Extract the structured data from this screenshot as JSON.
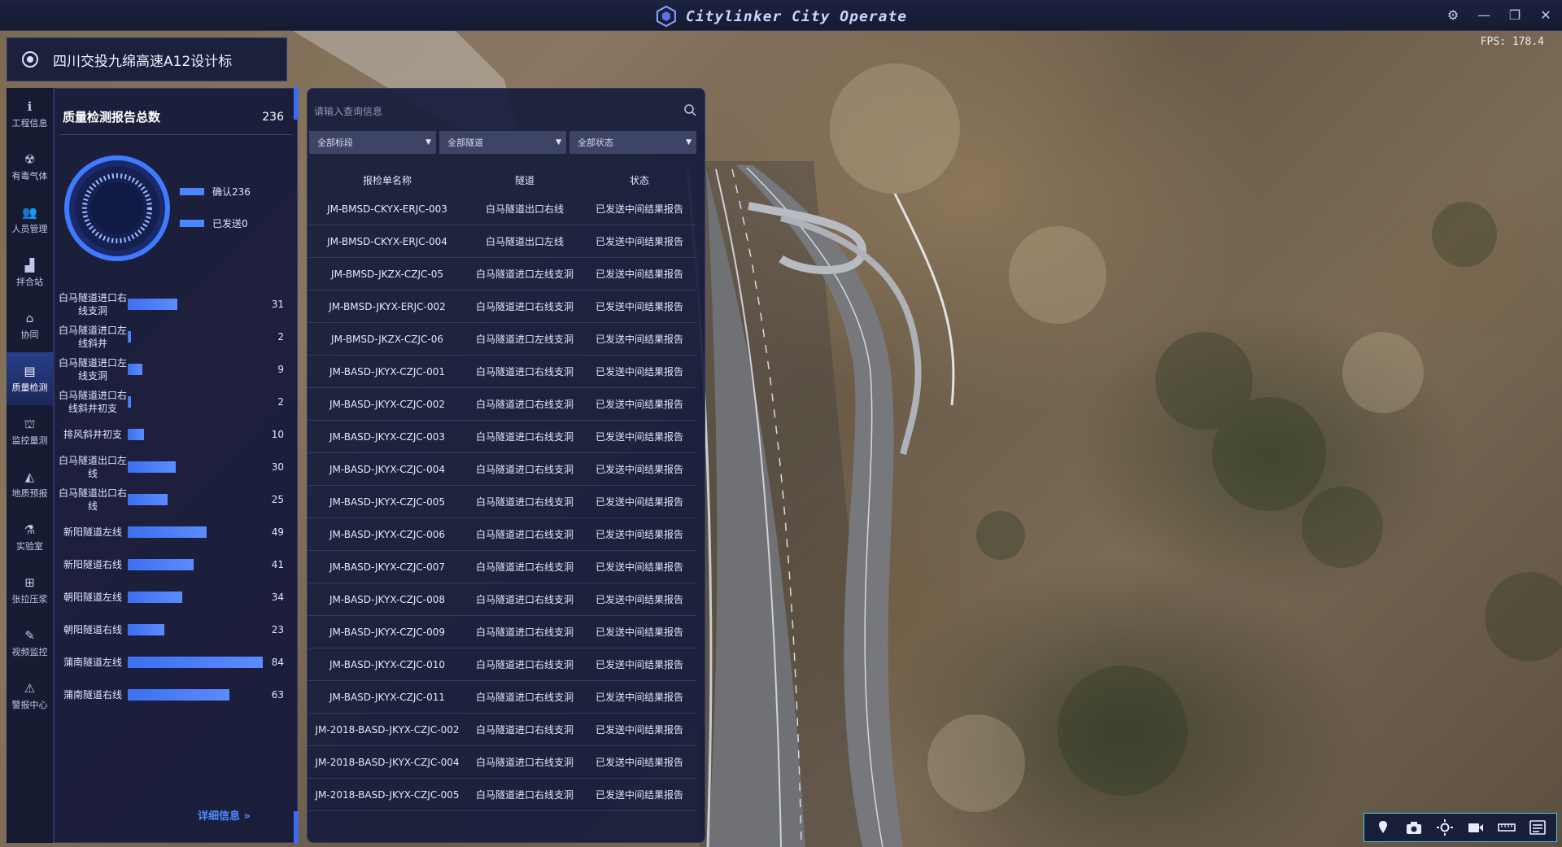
{
  "app": {
    "brand": "Citylinker City Operate",
    "fps": "FPS: 178.4"
  },
  "window_controls": [
    "settings-icon",
    "minimize-icon",
    "restore-icon",
    "close-icon"
  ],
  "project": {
    "title": "四川交投九绵高速A12设计标"
  },
  "nav": {
    "items": [
      {
        "label": "工程信息",
        "icon": "info-icon"
      },
      {
        "label": "有毒气体",
        "icon": "gas-icon"
      },
      {
        "label": "人员管理",
        "icon": "people-icon"
      },
      {
        "label": "拌合站",
        "icon": "plant-icon"
      },
      {
        "label": "协同",
        "icon": "cooperate-icon"
      },
      {
        "label": "质量检测",
        "icon": "quality-icon",
        "active": true
      },
      {
        "label": "监控量测",
        "icon": "monitor-icon"
      },
      {
        "label": "地质预报",
        "icon": "geology-icon"
      },
      {
        "label": "实验室",
        "icon": "lab-icon"
      },
      {
        "label": "张拉压浆",
        "icon": "tension-icon"
      },
      {
        "label": "视频监控",
        "icon": "video-icon"
      },
      {
        "label": "警报中心",
        "icon": "alarm-icon"
      }
    ]
  },
  "stats": {
    "title": "质量检测报告总数",
    "total": "236",
    "legend": {
      "confirmed": "确认236",
      "sent": "已发送0"
    },
    "detail_link": "详细信息",
    "max_value": 84,
    "bars": [
      {
        "label": "白马隧道进口右线支洞",
        "value": 31
      },
      {
        "label": "白马隧道进口左线斜井",
        "value": 2
      },
      {
        "label": "白马隧道进口左线支洞",
        "value": 9
      },
      {
        "label": "白马隧道进口右线斜井初支",
        "value": 2
      },
      {
        "label": "排风斜井初支",
        "value": 10
      },
      {
        "label": "白马隧道出口左线",
        "value": 30
      },
      {
        "label": "白马隧道出口右线",
        "value": 25
      },
      {
        "label": "新阳隧道左线",
        "value": 49
      },
      {
        "label": "新阳隧道右线",
        "value": 41
      },
      {
        "label": "朝阳隧道左线",
        "value": 34
      },
      {
        "label": "朝阳隧道右线",
        "value": 23
      },
      {
        "label": "蒲南隧道左线",
        "value": 84
      },
      {
        "label": "蒲南隧道右线",
        "value": 63
      }
    ]
  },
  "list": {
    "search_placeholder": "请输入查询信息",
    "filters": [
      "全部标段",
      "全部隧道",
      "全部状态"
    ],
    "columns": {
      "name": "报检单名称",
      "tunnel": "隧道",
      "status": "状态"
    },
    "rows": [
      {
        "name": "JM-BMSD-CKYX-ERJC-003",
        "tunnel": "白马隧道出口右线",
        "status": "已发送中间结果报告"
      },
      {
        "name": "JM-BMSD-CKYX-ERJC-004",
        "tunnel": "白马隧道出口左线",
        "status": "已发送中间结果报告"
      },
      {
        "name": "JM-BMSD-JKZX-CZJC-05",
        "tunnel": "白马隧道进口左线支洞",
        "status": "已发送中间结果报告"
      },
      {
        "name": "JM-BMSD-JKYX-ERJC-002",
        "tunnel": "白马隧道进口右线支洞",
        "status": "已发送中间结果报告"
      },
      {
        "name": "JM-BMSD-JKZX-CZJC-06",
        "tunnel": "白马隧道进口左线支洞",
        "status": "已发送中间结果报告"
      },
      {
        "name": "JM-BASD-JKYX-CZJC-001",
        "tunnel": "白马隧道进口右线支洞",
        "status": "已发送中间结果报告"
      },
      {
        "name": "JM-BASD-JKYX-CZJC-002",
        "tunnel": "白马隧道进口右线支洞",
        "status": "已发送中间结果报告"
      },
      {
        "name": "JM-BASD-JKYX-CZJC-003",
        "tunnel": "白马隧道进口右线支洞",
        "status": "已发送中间结果报告"
      },
      {
        "name": "JM-BASD-JKYX-CZJC-004",
        "tunnel": "白马隧道进口右线支洞",
        "status": "已发送中间结果报告"
      },
      {
        "name": "JM-BASD-JKYX-CZJC-005",
        "tunnel": "白马隧道进口右线支洞",
        "status": "已发送中间结果报告"
      },
      {
        "name": "JM-BASD-JKYX-CZJC-006",
        "tunnel": "白马隧道进口右线支洞",
        "status": "已发送中间结果报告"
      },
      {
        "name": "JM-BASD-JKYX-CZJC-007",
        "tunnel": "白马隧道进口右线支洞",
        "status": "已发送中间结果报告"
      },
      {
        "name": "JM-BASD-JKYX-CZJC-008",
        "tunnel": "白马隧道进口右线支洞",
        "status": "已发送中间结果报告"
      },
      {
        "name": "JM-BASD-JKYX-CZJC-009",
        "tunnel": "白马隧道进口右线支洞",
        "status": "已发送中间结果报告"
      },
      {
        "name": "JM-BASD-JKYX-CZJC-010",
        "tunnel": "白马隧道进口右线支洞",
        "status": "已发送中间结果报告"
      },
      {
        "name": "JM-BASD-JKYX-CZJC-011",
        "tunnel": "白马隧道进口右线支洞",
        "status": "已发送中间结果报告"
      },
      {
        "name": "JM-2018-BASD-JKYX-CZJC-002",
        "tunnel": "白马隧道进口右线支洞",
        "status": "已发送中间结果报告"
      },
      {
        "name": "JM-2018-BASD-JKYX-CZJC-004",
        "tunnel": "白马隧道进口右线支洞",
        "status": "已发送中间结果报告"
      },
      {
        "name": "JM-2018-BASD-JKYX-CZJC-005",
        "tunnel": "白马隧道进口右线支洞",
        "status": "已发送中间结果报告"
      }
    ]
  },
  "toolbar": [
    "pin-icon",
    "camera-icon",
    "sun-icon",
    "video-camera-icon",
    "ruler-icon",
    "layers-icon"
  ],
  "colors": {
    "accent": "#4f84ff",
    "panel": "#161b3a",
    "toolbar_border": "#35d2e6"
  }
}
